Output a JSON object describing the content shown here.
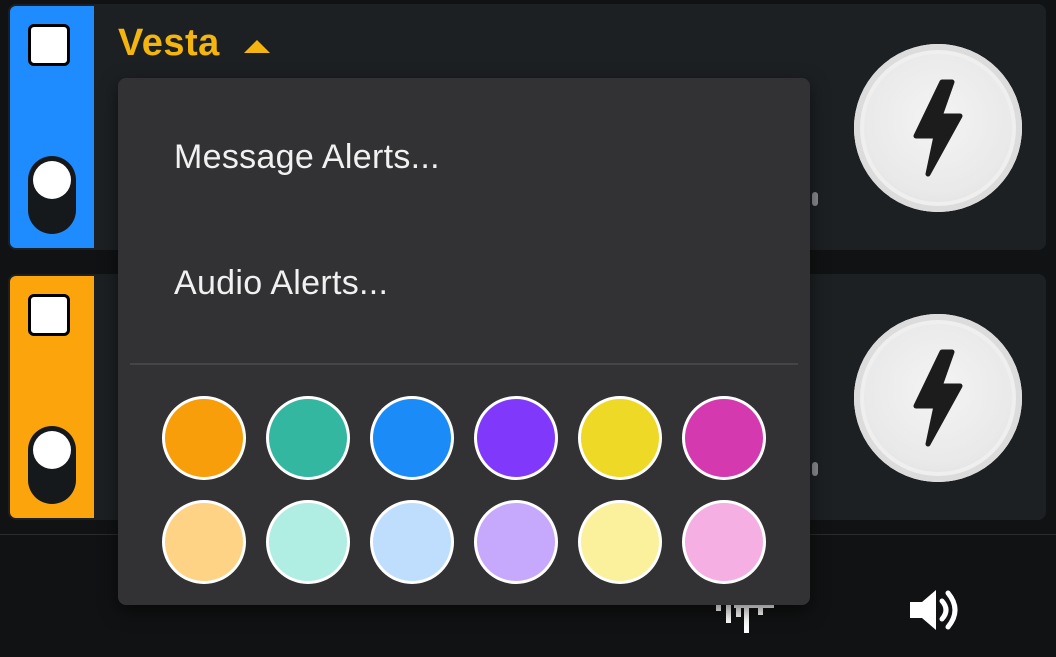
{
  "cards": [
    {
      "title": "Vesta",
      "strip_color": "#1e8bff",
      "checkbox_checked": false,
      "toggle_on": false
    },
    {
      "title": "",
      "strip_color": "#fba40c",
      "checkbox_checked": false,
      "toggle_on": false
    }
  ],
  "menu": {
    "items": [
      {
        "label": "Message Alerts..."
      },
      {
        "label": "Audio Alerts..."
      }
    ],
    "swatches": [
      "#f89e0b",
      "#34b7a1",
      "#1a8bf7",
      "#8039fb",
      "#efd927",
      "#d539b0",
      "#fed385",
      "#b0ede3",
      "#bfdefe",
      "#c6a8fd",
      "#fbf19d",
      "#f5afe2"
    ]
  },
  "bottom_bar": {
    "icons": [
      "transmit-icon",
      "speaker-icon"
    ]
  },
  "icons": {
    "bolt": "lightning-bolt-icon",
    "caret": "caret-up-icon"
  }
}
